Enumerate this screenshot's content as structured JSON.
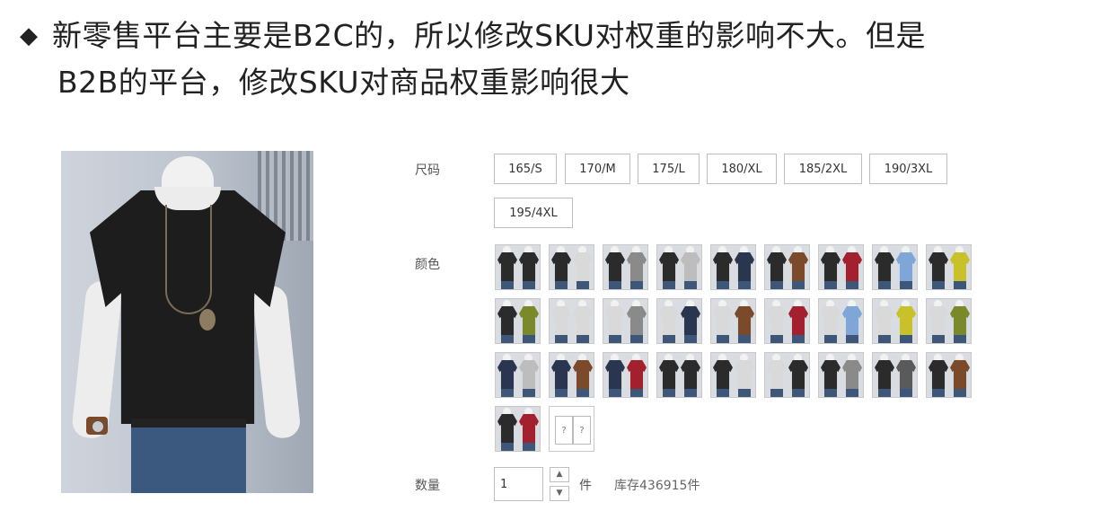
{
  "headline": {
    "bullet": "◆",
    "line1": "新零售平台主要是B2C的，所以修改SKU对权重的影响不大。但是",
    "line2": "B2B的平台，修改SKU对商品权重影响很大"
  },
  "product": {
    "size_label": "尺码",
    "sizes": [
      "165/S",
      "170/M",
      "175/L",
      "180/XL",
      "185/2XL",
      "190/3XL",
      "195/4XL"
    ],
    "color_label": "颜色",
    "color_options": [
      [
        "#2b2b2b",
        "#2b2b2b"
      ],
      [
        "#2b2b2b",
        "#d9d9d9"
      ],
      [
        "#2b2b2b",
        "#8a8a8a"
      ],
      [
        "#2b2b2b",
        "#bdbdbd"
      ],
      [
        "#2b2b2b",
        "#2a3550"
      ],
      [
        "#2b2b2b",
        "#7a4a2a"
      ],
      [
        "#2b2b2b",
        "#a3202e"
      ],
      [
        "#2b2b2b",
        "#7ea7d8"
      ],
      [
        "#2b2b2b",
        "#c8c12a"
      ],
      [
        "#2b2b2b",
        "#7a8a2a"
      ],
      [
        "#d9d9d9",
        "#d9d9d9"
      ],
      [
        "#d9d9d9",
        "#8a8a8a"
      ],
      [
        "#d9d9d9",
        "#2a3550"
      ],
      [
        "#d9d9d9",
        "#7a4a2a"
      ],
      [
        "#d9d9d9",
        "#a3202e"
      ],
      [
        "#d9d9d9",
        "#7ea7d8"
      ],
      [
        "#d9d9d9",
        "#c8c12a"
      ],
      [
        "#d9d9d9",
        "#7a8a2a"
      ],
      [
        "#2a3550",
        "#bdbdbd"
      ],
      [
        "#2a3550",
        "#7a4a2a"
      ],
      [
        "#2a3550",
        "#a3202e"
      ],
      [
        "#2b2b2b",
        "#2b2b2b"
      ],
      [
        "#2b2b2b",
        "#d9d9d9"
      ],
      [
        "#d9d9d9",
        "#2b2b2b"
      ],
      [
        "#2b2b2b",
        "#8a8a8a"
      ],
      [
        "#2b2b2b",
        "#5a5a5a"
      ],
      [
        "#2b2b2b",
        "#7a4a2a"
      ],
      [
        "#2b2b2b",
        "#a3202e"
      ],
      [
        "placeholder",
        "placeholder"
      ]
    ],
    "quantity_label": "数量",
    "quantity_value": "1",
    "stepper_up": "▲",
    "stepper_down": "▼",
    "unit": "件",
    "stock_text": "库存436915件"
  }
}
